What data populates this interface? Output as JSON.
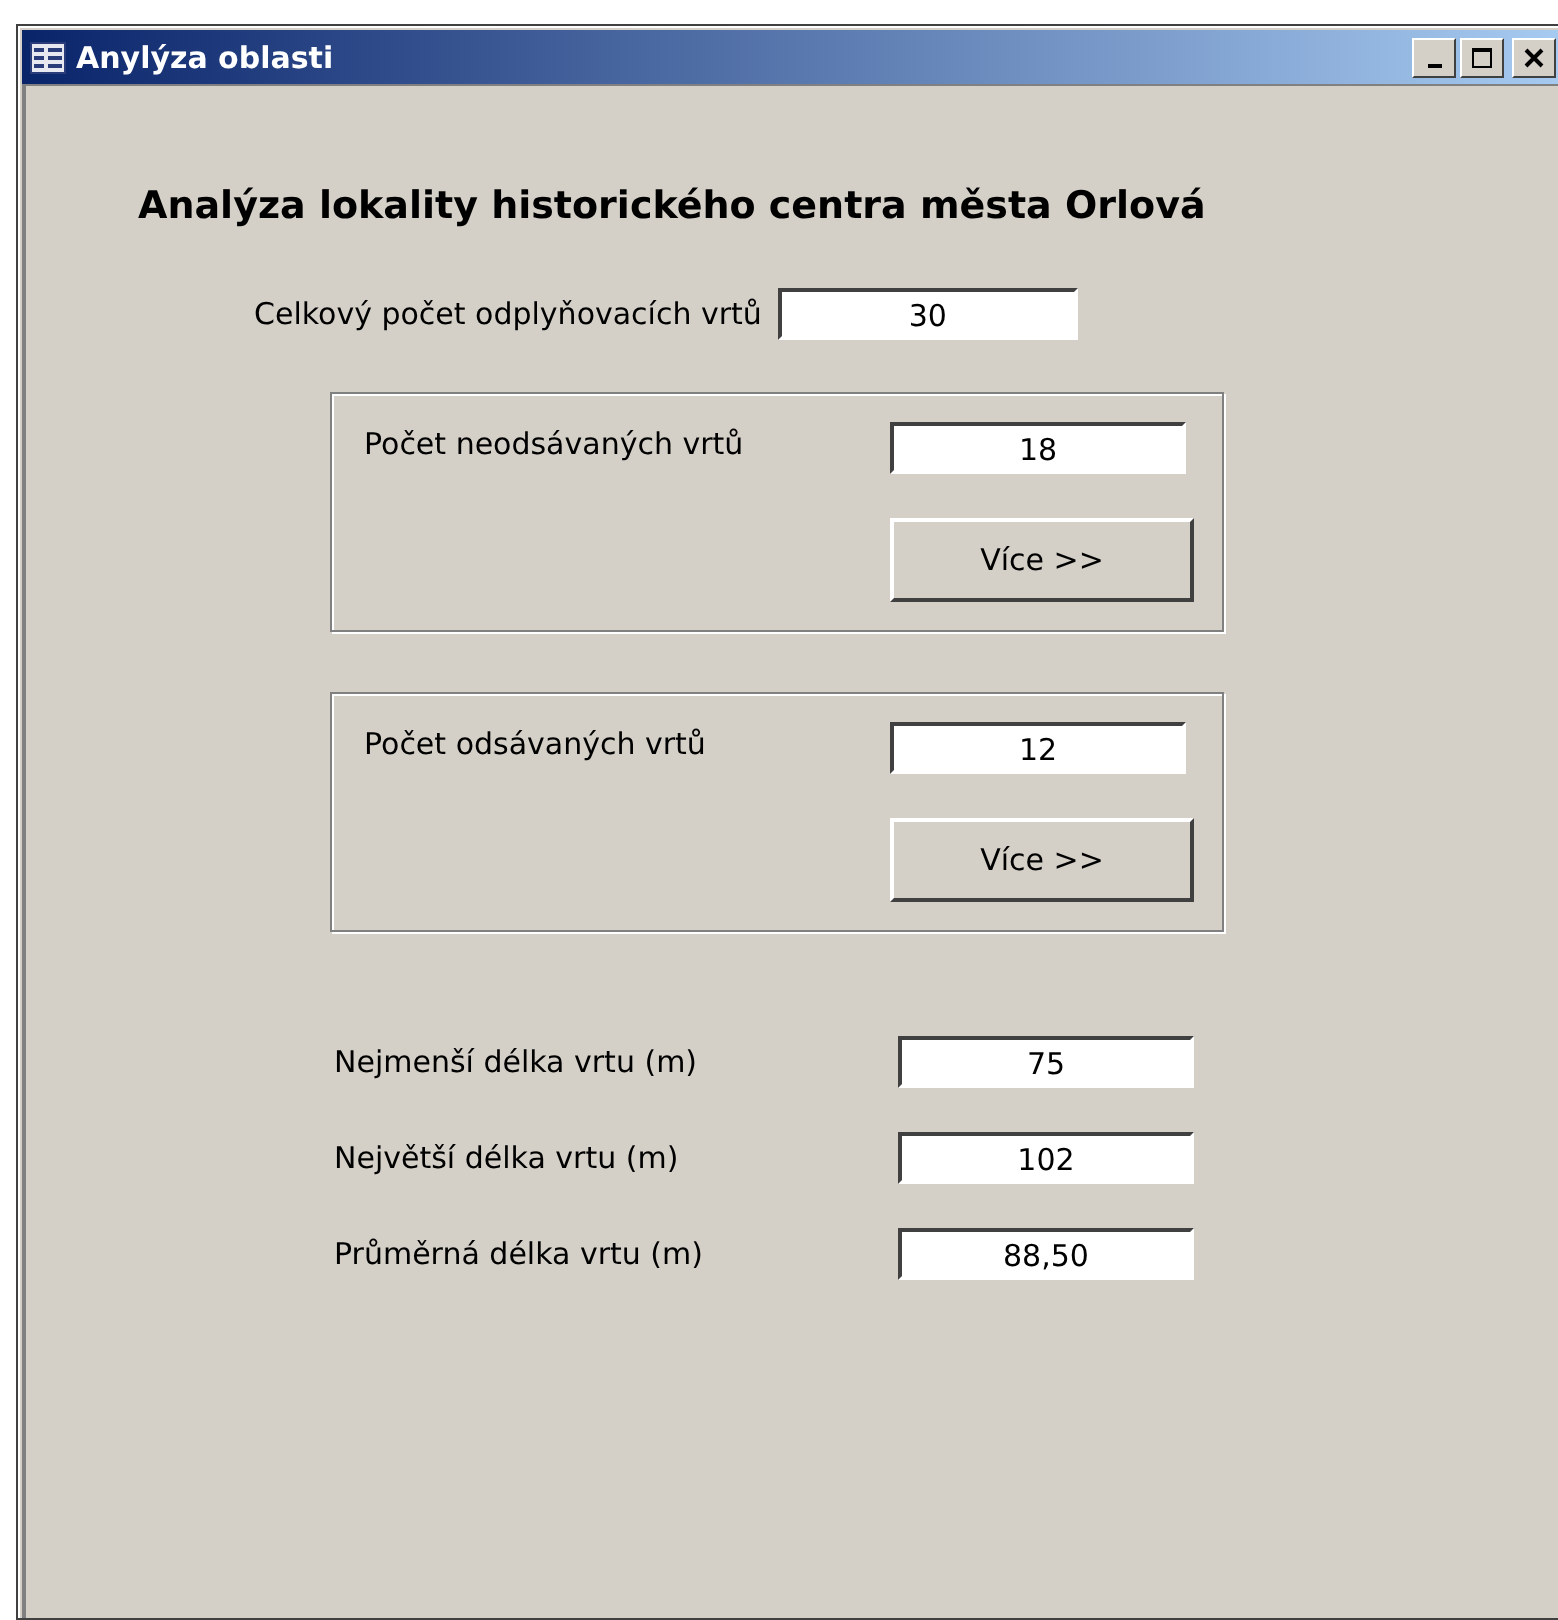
{
  "window": {
    "title": "Anylýza oblasti"
  },
  "heading": "Analýza lokality historického centra města Orlová",
  "total": {
    "label": "Celkový počet odplyňovacích vrtů",
    "value": "30"
  },
  "groups": [
    {
      "label": "Počet neodsávaných vrtů",
      "value": "18",
      "button": "Více >>"
    },
    {
      "label": "Počet odsávaných vrtů",
      "value": "12",
      "button": "Více >>"
    }
  ],
  "lengths": [
    {
      "label": "Nejmenší délka vrtu (m)",
      "value": "75"
    },
    {
      "label": "Největší délka vrtu (m)",
      "value": "102"
    },
    {
      "label": "Průměrná délka vrtu (m)",
      "value": "88,50"
    }
  ]
}
